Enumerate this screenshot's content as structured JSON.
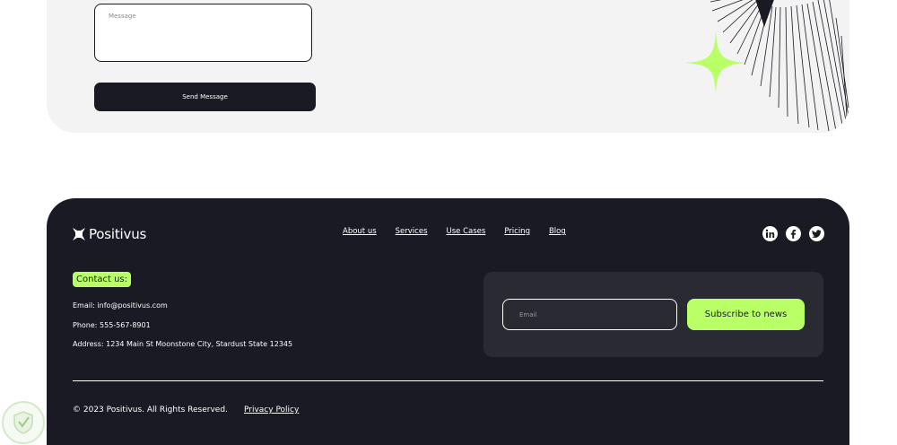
{
  "contact_form": {
    "message_placeholder": "Message",
    "send_label": "Send Message"
  },
  "footer": {
    "brand": "Positivus",
    "nav": [
      "About us",
      "Services",
      "Use Cases",
      "Pricing",
      "Blog"
    ],
    "socials": [
      "linkedin-icon",
      "facebook-icon",
      "twitter-icon"
    ],
    "contact_badge": "Contact us:",
    "email_line": "Email: info@positivus.com",
    "phone_line": "Phone: 555-567-8901",
    "address_line": "Address: 1234 Main St Moonstone City, Stardust State 12345",
    "subscribe": {
      "email_placeholder": "Email",
      "button_label": "Subscribe to news"
    },
    "copyright": "© 2023 Positivus. All Rights Reserved.",
    "privacy": "Privacy Policy"
  },
  "colors": {
    "dark": "#191a23",
    "accent": "#b9ff66",
    "panel": "#292a32",
    "light_bg": "#f3f3f3"
  }
}
